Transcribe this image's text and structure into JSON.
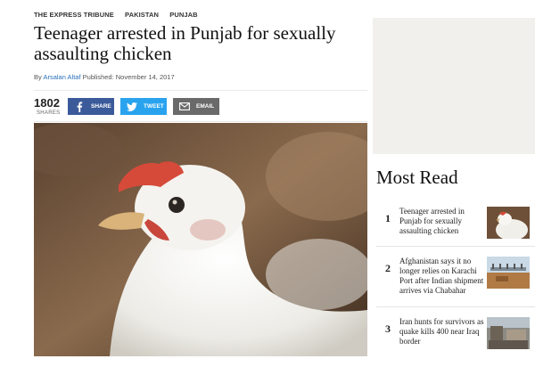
{
  "breadcrumb": [
    "THE EXPRESS TRIBUNE",
    "PAKISTAN",
    "PUNJAB"
  ],
  "headline": "Teenager arrested in Punjab for sexually assaulting chicken",
  "byline": {
    "prefix": "By",
    "author": "Arsalan Altaf",
    "published": "Published: November 14, 2017"
  },
  "share": {
    "count": "1802",
    "count_label": "SHARES",
    "facebook_label": "SHARE",
    "twitter_label": "TWEET",
    "email_label": "EMAIL"
  },
  "colors": {
    "facebook": "#3b5a9a",
    "twitter": "#2aa3ef",
    "email": "#6a6a6a",
    "author_link": "#2a6fb8"
  },
  "hero_image": {
    "subject": "white chicken close-up"
  },
  "sidebar": {
    "most_read_title": "Most Read",
    "items": [
      {
        "rank": "1",
        "title": "Teenager arrested in Punjab for sexually assaulting chicken"
      },
      {
        "rank": "2",
        "title": "Afghanistan says it no longer relies on Karachi Port after Indian shipment arrives via Chabahar"
      },
      {
        "rank": "3",
        "title": "Iran hunts for survivors as quake kills 400 near Iraq border"
      }
    ]
  }
}
